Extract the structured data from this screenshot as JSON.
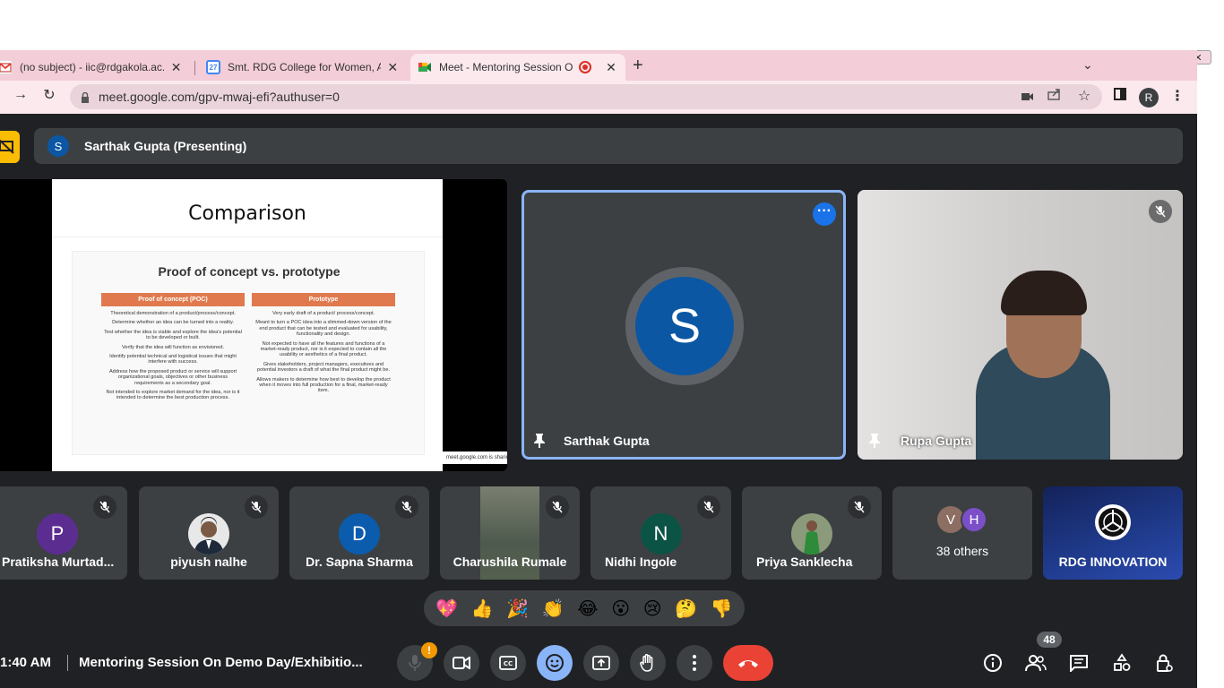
{
  "browser": {
    "tabs": [
      {
        "title": "(no subject) - iic@rdgakola.ac.in - S",
        "icon": "gmail-icon"
      },
      {
        "title": "Smt. RDG College for Women, Akola",
        "icon": "calendar-icon",
        "icon_text": "27"
      },
      {
        "title": "Meet - Mentoring Session On D",
        "icon": "meet-icon"
      }
    ],
    "url": "meet.google.com/gpv-mwaj-efi?authuser=0",
    "profile_initial": "R"
  },
  "presenting": {
    "avatar_initial": "S",
    "label": "Sarthak Gupta (Presenting)"
  },
  "slide": {
    "title": "Comparison",
    "subtitle": "Proof of concept vs. prototype",
    "col1_head": "Proof of concept (POC)",
    "col2_head": "Prototype",
    "col1_items": [
      "Theoretical demonstration of a product/process/concept.",
      "Determine whether an idea can be turned into a reality.",
      "Test whether the idea is viable and explore the idea's potential to be developed or built.",
      "Verify that the idea will function as envisioned.",
      "Identify potential technical and logistical issues that might interfere with success.",
      "Address how the proposed product or service will support organizational goals, objectives or other business requirements as a secondary goal.",
      "Not intended to explore market demand for the idea, nor is it intended to determine the best production process."
    ],
    "col2_items": [
      "Very early draft of a product/ process/concept.",
      "Meant to turn a POC idea into a slimmed-down version of the end product that can be tested and evaluated for usability, functionality and design.",
      "Not expected to have all the features and functions of a market-ready product, nor is it expected to contain all the usability or aesthetics of a final product.",
      "Gives stakeholders, project managers, executives and potential investors a draft of what the final product might be.",
      "Allows makers to determine how best to develop the product when it moves into full production for a final, market-ready item."
    ],
    "share_tag": "meet.google.com is sharing"
  },
  "main_tiles": {
    "sarthak": {
      "name": "Sarthak Gupta",
      "initial": "S"
    },
    "rupa": {
      "name": "Rupa Gupta"
    }
  },
  "participants": [
    {
      "name": "Pratiksha Murtad...",
      "initial": "P",
      "color": "#5c2d91"
    },
    {
      "name": "piyush nalhe",
      "initial": "",
      "color": "#e8e8e8"
    },
    {
      "name": "Dr. Sapna Sharma",
      "initial": "D",
      "color": "#0b5cad"
    },
    {
      "name": "Charushila Rumale",
      "initial": "",
      "color": "#5f6b5e"
    },
    {
      "name": "Nidhi Ingole",
      "initial": "N",
      "color": "#0b5345"
    },
    {
      "name": "Priya Sanklecha",
      "initial": "",
      "color": "#8a9a7a"
    }
  ],
  "others": {
    "v": "V",
    "h": "H",
    "label": "38 others"
  },
  "rdg": {
    "name": "RDG INNOVATION"
  },
  "reactions": [
    "💖",
    "👍",
    "🎉",
    "👏",
    "😂",
    "😮",
    "😢",
    "🤔",
    "👎"
  ],
  "meeting": {
    "time": "1:40 AM",
    "title": "Mentoring Session On Demo Day/Exhibitio...",
    "people_count": "48"
  }
}
